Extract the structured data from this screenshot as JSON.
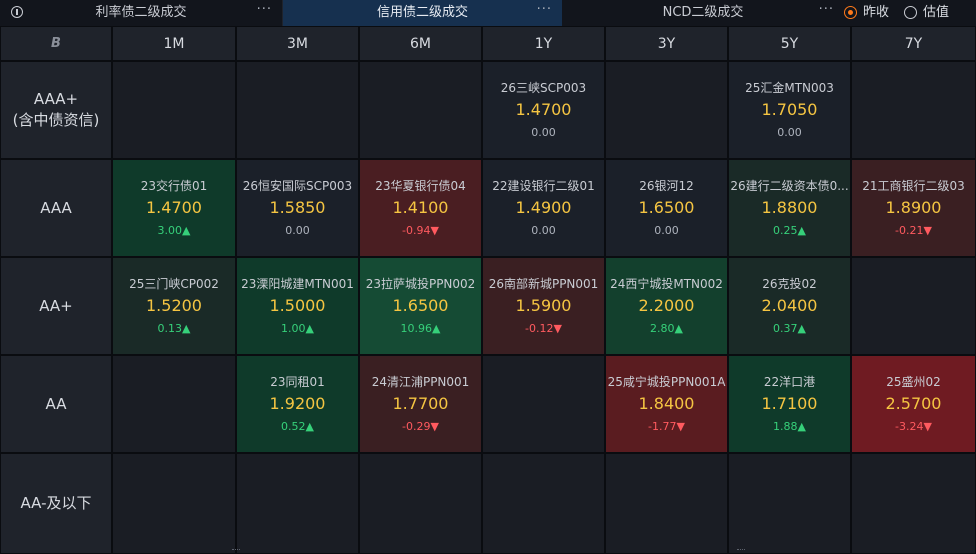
{
  "tabs": [
    {
      "label": "利率债二级成交",
      "more": "···"
    },
    {
      "label": "信用债二级成交",
      "more": "···"
    },
    {
      "label": "NCD二级成交",
      "more": "···"
    }
  ],
  "radio": [
    {
      "label": "昨收",
      "checked": true
    },
    {
      "label": "估值",
      "checked": false
    }
  ],
  "corner_logo": "B",
  "tenors": [
    "1M",
    "3M",
    "6M",
    "1Y",
    "3Y",
    "5Y",
    "7Y"
  ],
  "ratings": [
    "AAA+\n(含中债资信)",
    "AAA",
    "AA+",
    "AA",
    "AA-及以下"
  ],
  "cells": [
    [
      null,
      null,
      null,
      {
        "name": "26三峡SCP003",
        "rate": "1.4700",
        "change": "0.00",
        "dir": "flat",
        "tone": "n0"
      },
      null,
      {
        "name": "25汇金MTN003",
        "rate": "1.7050",
        "change": "0.00",
        "dir": "flat",
        "tone": "n0"
      },
      null
    ],
    [
      {
        "name": "23交行债01",
        "rate": "1.4700",
        "change": "3.00▲",
        "dir": "up",
        "tone": "g1"
      },
      {
        "name": "26恒安国际SCP003",
        "rate": "1.5850",
        "change": "0.00",
        "dir": "flat",
        "tone": "n0"
      },
      {
        "name": "23华夏银行债04",
        "rate": "1.4100",
        "change": "-0.94▼",
        "dir": "down",
        "tone": "r2"
      },
      {
        "name": "22建设银行二级01",
        "rate": "1.4900",
        "change": "0.00",
        "dir": "flat",
        "tone": "n0"
      },
      {
        "name": "26银河12",
        "rate": "1.6500",
        "change": "0.00",
        "dir": "flat",
        "tone": "n0"
      },
      {
        "name": "26建行二级资本债0...",
        "rate": "1.8800",
        "change": "0.25▲",
        "dir": "up",
        "tone": "g0"
      },
      {
        "name": "21工商银行二级03",
        "rate": "1.8900",
        "change": "-0.21▼",
        "dir": "down",
        "tone": "r1"
      }
    ],
    [
      {
        "name": "25三门峡CP002",
        "rate": "1.5200",
        "change": "0.13▲",
        "dir": "up",
        "tone": "g0"
      },
      {
        "name": "23溧阳城建MTN001",
        "rate": "1.5000",
        "change": "1.00▲",
        "dir": "up",
        "tone": "g1"
      },
      {
        "name": "23拉萨城投PPN002",
        "rate": "1.6500",
        "change": "10.96▲",
        "dir": "up",
        "tone": "g3"
      },
      {
        "name": "26南部新城PPN001",
        "rate": "1.5900",
        "change": "-0.12▼",
        "dir": "down",
        "tone": "r1"
      },
      {
        "name": "24西宁城投MTN002",
        "rate": "2.2000",
        "change": "2.80▲",
        "dir": "up",
        "tone": "g2"
      },
      {
        "name": "26克投02",
        "rate": "2.0400",
        "change": "0.37▲",
        "dir": "up",
        "tone": "g0"
      },
      null
    ],
    [
      null,
      {
        "name": "23同租01",
        "rate": "1.9200",
        "change": "0.52▲",
        "dir": "up",
        "tone": "g1"
      },
      {
        "name": "24清江浦PPN001",
        "rate": "1.7700",
        "change": "-0.29▼",
        "dir": "down",
        "tone": "r1"
      },
      null,
      {
        "name": "25咸宁城投PPN001A",
        "rate": "1.8400",
        "change": "-1.77▼",
        "dir": "down",
        "tone": "r3"
      },
      {
        "name": "22洋口港",
        "rate": "1.7100",
        "change": "1.88▲",
        "dir": "up",
        "tone": "g1"
      },
      {
        "name": "25盛州02",
        "rate": "2.5700",
        "change": "-3.24▼",
        "dir": "down",
        "tone": "r4"
      }
    ],
    [
      null,
      null,
      null,
      null,
      null,
      null,
      null
    ]
  ]
}
